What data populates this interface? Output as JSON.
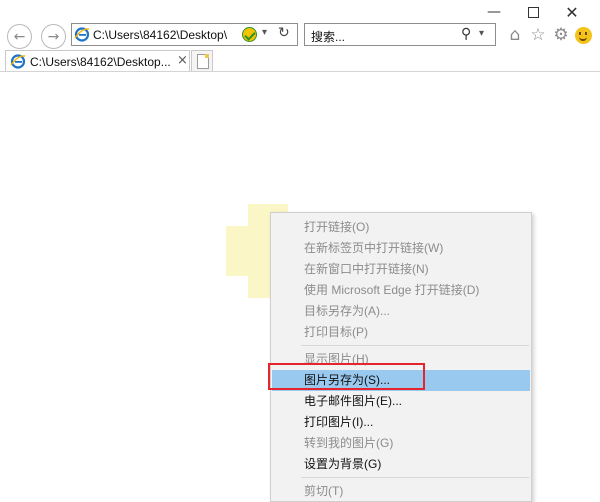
{
  "window": {
    "minimize_icon": "minimize-icon",
    "maximize_icon": "maximize-icon",
    "close_icon": "close-icon"
  },
  "nav": {
    "back_icon": "back-arrow-icon",
    "forward_icon": "forward-arrow-icon",
    "address": "C:\\Users\\84162\\Desktop\\",
    "search_placeholder": "搜索..."
  },
  "toolbar": {
    "icons": [
      "home-icon",
      "favorites-star-icon",
      "settings-gear-icon",
      "feedback-smiley-icon"
    ]
  },
  "tabs": [
    {
      "label": "C:\\Users\\84162\\Desktop...",
      "close_glyph": "×"
    }
  ],
  "context_menu": {
    "groups": [
      [
        {
          "label": "打开链接(O)",
          "state": "disabled"
        },
        {
          "label": "在新标签页中打开链接(W)",
          "state": "disabled"
        },
        {
          "label": "在新窗口中打开链接(N)",
          "state": "disabled"
        },
        {
          "label": "使用 Microsoft Edge 打开链接(D)",
          "state": "disabled"
        },
        {
          "label": "目标另存为(A)...",
          "state": "disabled"
        },
        {
          "label": "打印目标(P)",
          "state": "disabled"
        }
      ],
      [
        {
          "label": "显示图片(H)",
          "state": "disabled"
        },
        {
          "label": "图片另存为(S)...",
          "state": "highlighted"
        },
        {
          "label": "电子邮件图片(E)...",
          "state": "enabled"
        },
        {
          "label": "打印图片(I)...",
          "state": "enabled"
        },
        {
          "label": "转到我的图片(G)",
          "state": "disabled"
        },
        {
          "label": "设置为背景(G)",
          "state": "enabled"
        }
      ],
      [
        {
          "label": "剪切(T)",
          "state": "disabled"
        }
      ]
    ]
  },
  "colors": {
    "highlight": "#99c9ef",
    "annotation_box": "#e3262e",
    "page_image": "#fbf6c6",
    "menu_background": "#f2f2f2"
  }
}
